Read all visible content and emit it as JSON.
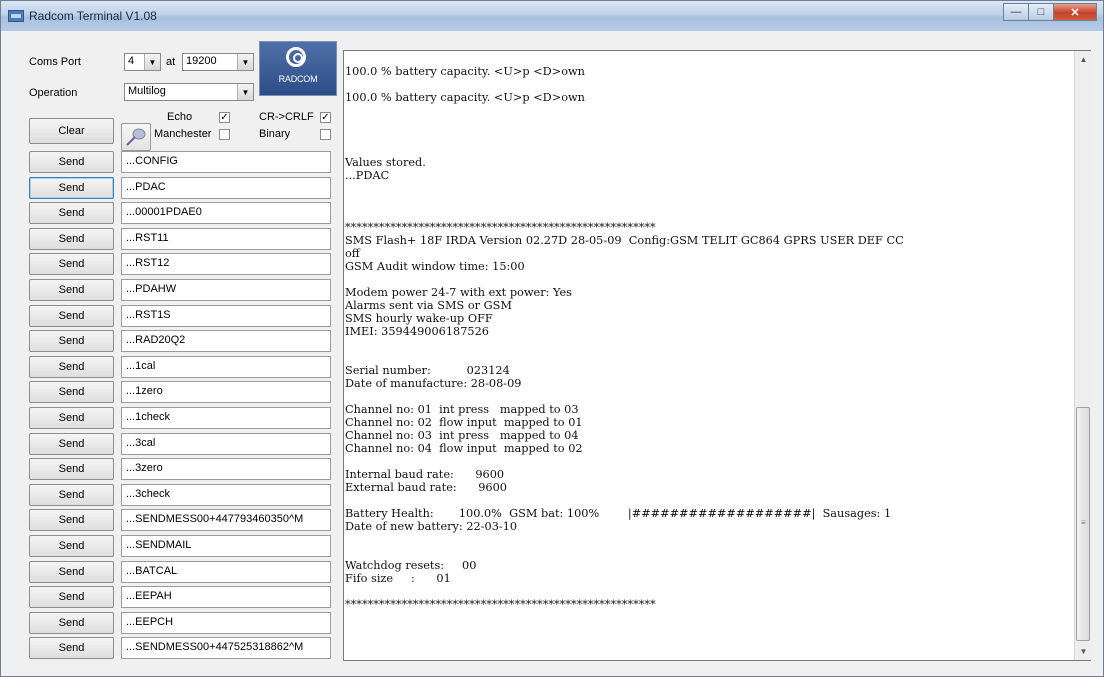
{
  "window": {
    "title": "Radcom Terminal V1.08"
  },
  "controls": {
    "coms_port_label": "Coms Port",
    "coms_port_value": "4",
    "at_label": "at",
    "baud_value": "19200",
    "operation_label": "Operation",
    "operation_value": "Multilog",
    "clear_label": "Clear",
    "echo_label": "Echo",
    "echo_checked": "✓",
    "crlf_label": "CR->CRLF",
    "crlf_checked": "✓",
    "manchester_label": "Manchester",
    "binary_label": "Binary",
    "logo_text": "RADCOM"
  },
  "send_label": "Send",
  "commands": [
    "...CONFIG",
    "...PDAC",
    "...00001PDAE0",
    "...RST11",
    "...RST12",
    "...PDAHW",
    "...RST1S",
    "...RAD20Q2",
    "...1cal",
    "...1zero",
    "...1check",
    "...3cal",
    "...3zero",
    "...3check",
    "...SENDMESS00+447793460350^M",
    "...SENDMAIL",
    "...BATCAL",
    "...EEPAH",
    "...EEPCH",
    "...SENDMESS00+447525318862^M"
  ],
  "terminal_text": "100.0 % battery capacity. <U>p <D>own\n\n100.0 % battery capacity. <U>p <D>own\n\n\n\n\nValues stored.\n...PDAC\n\n\n\n*******************************************************\nSMS Flash+ 18F IRDA Version 02.27D 28-05-09  Config:GSM TELIT GC864 GPRS USER DEF CC\noff\nGSM Audit window time: 15:00\n\nModem power 24-7 with ext power: Yes\nAlarms sent via SMS or GSM\nSMS hourly wake-up OFF\nIMEI: 359449006187526\n\n\nSerial number:          023124\nDate of manufacture: 28-08-09\n\nChannel no: 01  int press   mapped to 03\nChannel no: 02  flow input  mapped to 01\nChannel no: 03  int press   mapped to 04\nChannel no: 04  flow input  mapped to 02\n\nInternal baud rate:      9600\nExternal baud rate:      9600\n\nBattery Health:       100.0%  GSM bat: 100%        |###################|  Sausages: 1\nDate of new battery: 22-03-10\n\n\nWatchdog resets:     00\nFifo size     :      01\n\n*******************************************************"
}
